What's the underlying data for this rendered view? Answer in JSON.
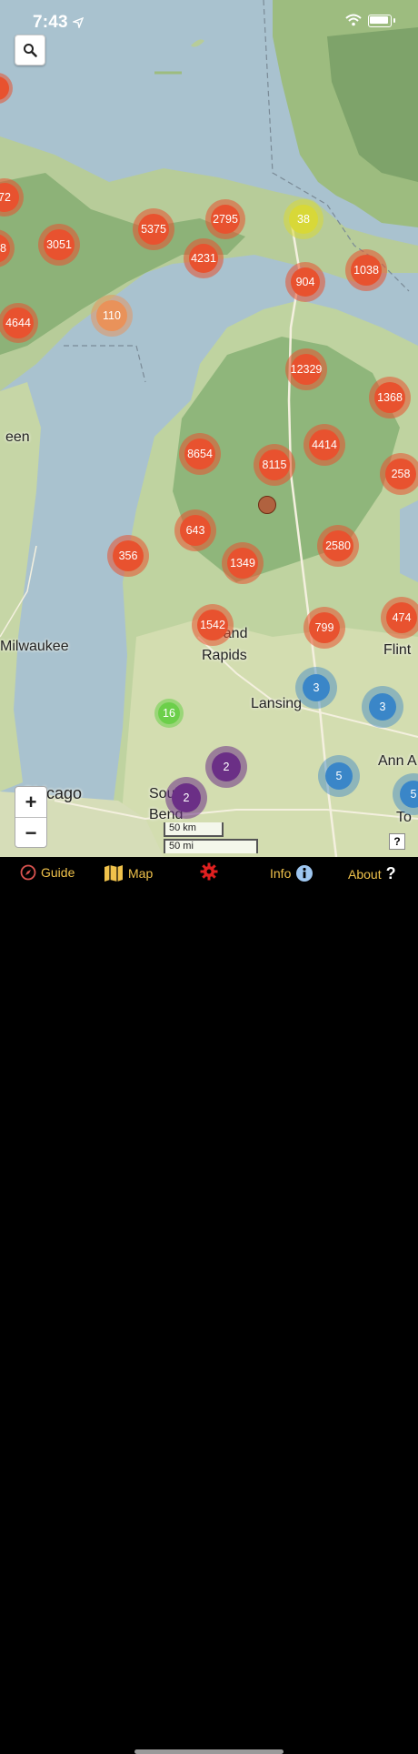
{
  "status_bar": {
    "time": "7:43"
  },
  "map": {
    "places": [
      "een",
      "Milwaukee",
      "Chicago",
      "Grand",
      "Rapids",
      "Lansing",
      "Flint",
      "Ann A",
      "South",
      "Bend",
      "To"
    ],
    "scale": {
      "km": "50 km",
      "mi": "50 mi"
    },
    "attribution": "?",
    "clusters": [
      "72",
      "3051",
      "5375",
      "2795",
      "38",
      "4231",
      "904",
      "1038",
      "8",
      "4644",
      "110",
      "12329",
      "1368",
      "8654",
      "8115",
      "4414",
      "258",
      "643",
      "356",
      "1349",
      "2580",
      "1542",
      "799",
      "474",
      "3",
      "3",
      "16",
      "2",
      "5",
      "2",
      "5"
    ],
    "zoom_in": "+",
    "zoom_out": "−"
  },
  "tabs": {
    "guide": "Guide",
    "map": "Map",
    "info": "Info",
    "about": "About"
  },
  "colors": {
    "accent": "#f0c24b",
    "cluster_red": "#e8522f",
    "cluster_orange": "#e9925a",
    "cluster_yellow": "#d8d838",
    "cluster_blue": "#3a86c8",
    "cluster_purple": "#6b2f86",
    "cluster_green": "#6ccf4a"
  }
}
